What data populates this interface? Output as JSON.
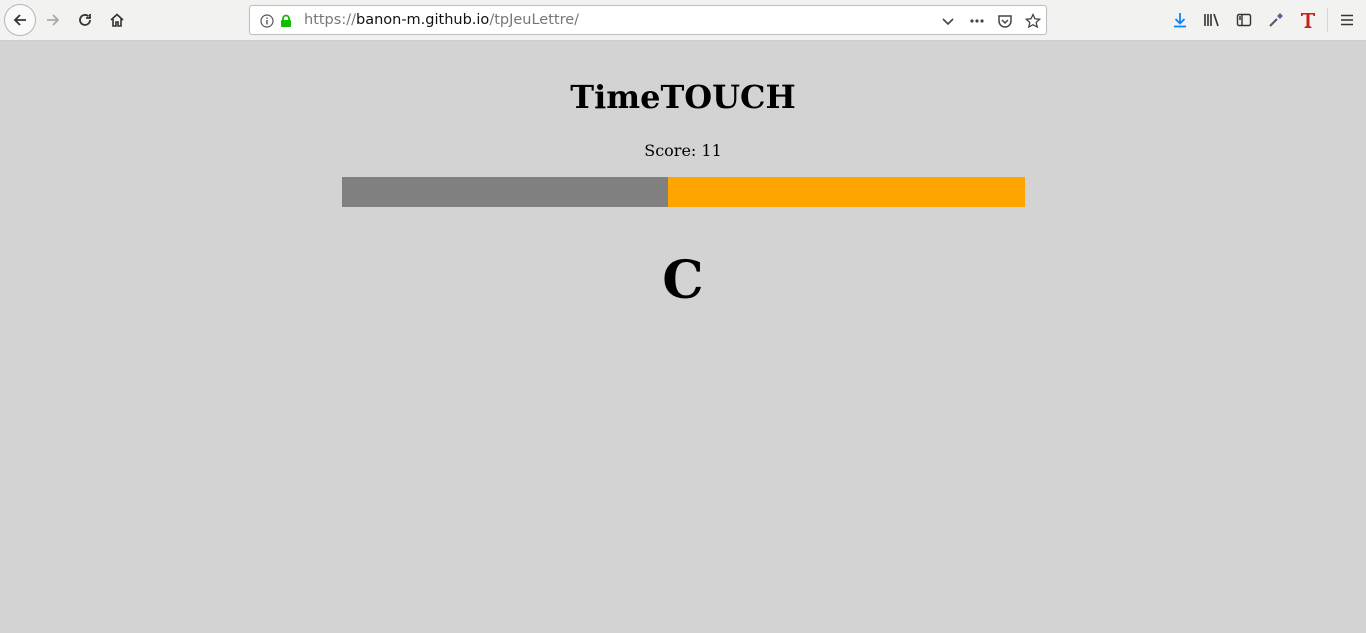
{
  "browser": {
    "url_scheme": "https://",
    "url_host": "banon-m.github.io",
    "url_path": "/tpJeuLettre/",
    "icons": [
      "back-icon",
      "forward-icon",
      "reload-icon",
      "home-icon",
      "info-icon",
      "lock-icon",
      "chevron-down-icon",
      "more-icon",
      "pocket-icon",
      "bookmark-star-icon",
      "download-icon",
      "library-icon",
      "sidebar-icon",
      "eyedropper-icon",
      "t-extension-icon",
      "menu-icon"
    ]
  },
  "game": {
    "title": "TimeTOUCH",
    "score_label": "Score: 11",
    "letter": "C",
    "timer_elapsed_fraction": 0.478,
    "colors": {
      "background": "#d3d3d3",
      "elapsed": "#808080",
      "remaining": "#ffa500"
    }
  }
}
